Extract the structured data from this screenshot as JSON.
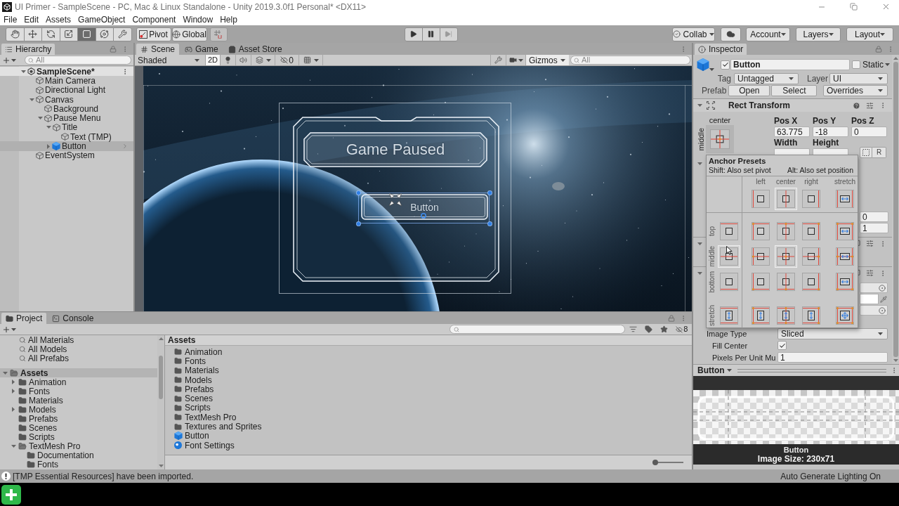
{
  "window": {
    "title": "UI Primer - SampleScene - PC, Mac & Linux Standalone - Unity 2019.3.0f1 Personal* <DX11>"
  },
  "menu": [
    "File",
    "Edit",
    "Assets",
    "GameObject",
    "Component",
    "Window",
    "Help"
  ],
  "toolbar": {
    "tools": [
      {
        "kind": "hand",
        "selected": false
      },
      {
        "kind": "move",
        "selected": false
      },
      {
        "kind": "rotate",
        "selected": false
      },
      {
        "kind": "scale",
        "selected": false
      },
      {
        "kind": "rect",
        "selected": true
      },
      {
        "kind": "transform",
        "selected": false
      },
      {
        "kind": "custom",
        "selected": false
      }
    ],
    "pivot": "Pivot",
    "global": "Global",
    "snap": {
      "disabled": true
    },
    "playback": [
      {
        "kind": "play",
        "disabled": false
      },
      {
        "kind": "pause",
        "disabled": false
      },
      {
        "kind": "step",
        "disabled": true
      }
    ],
    "collab": "Collab",
    "account": "Account",
    "layers": "Layers",
    "layout": "Layout"
  },
  "hierarchy": {
    "title": "Hierarchy",
    "search_placeholder": "All",
    "tree": [
      {
        "label": "SampleScene*",
        "kind": "scene",
        "expanded": true,
        "selected": false,
        "children": [
          {
            "label": "Main Camera",
            "kind": "object",
            "selected": false
          },
          {
            "label": "Directional Light",
            "kind": "object",
            "selected": false
          },
          {
            "label": "Canvas",
            "kind": "object",
            "expanded": true,
            "selected": false,
            "children": [
              {
                "label": "Background",
                "kind": "object",
                "selected": false
              },
              {
                "label": "Pause Menu",
                "kind": "object",
                "expanded": true,
                "selected": false,
                "children": [
                  {
                    "label": "Title",
                    "kind": "object",
                    "expanded": true,
                    "selected": false,
                    "children": [
                      {
                        "label": "Text (TMP)",
                        "kind": "object",
                        "selected": false
                      }
                    ]
                  },
                  {
                    "label": "Button",
                    "kind": "prefab",
                    "expanded": false,
                    "selected": true
                  }
                ]
              }
            ]
          },
          {
            "label": "EventSystem",
            "kind": "object",
            "selected": false
          }
        ]
      }
    ]
  },
  "scene_view": {
    "tabs": [
      {
        "label": "Scene",
        "kind": "scene",
        "selected": true
      },
      {
        "label": "Game",
        "kind": "game",
        "selected": false
      },
      {
        "label": "Asset Store",
        "kind": "store",
        "selected": false
      }
    ],
    "shading": "Shaded",
    "mode_2d": {
      "label": "2D",
      "on": true
    },
    "lighting": {
      "on": false
    },
    "audio": {
      "on": false
    },
    "hidden_count": "0",
    "tools": {
      "on": false
    },
    "gizmos": "Gizmos",
    "search_placeholder": "All",
    "title_text": "Game Paused",
    "button_text": "Button"
  },
  "inspector": {
    "title": "Inspector",
    "object": {
      "active": true,
      "name": "Button",
      "static": false,
      "static_label": "Static"
    },
    "tag_label": "Tag",
    "tag": "Untagged",
    "layer_label": "Layer",
    "layer": "UI",
    "prefab_label": "Prefab",
    "prefab_buttons": [
      "Open",
      "Select"
    ],
    "overrides": "Overrides",
    "rect_transform": {
      "title": "Rect Transform",
      "anchor_h_label": "center",
      "anchor_v_label": "middle",
      "fields": [
        {
          "label": "Pos X",
          "value": "63.775"
        },
        {
          "label": "Pos Y",
          "value": "-18"
        },
        {
          "label": "Pos Z",
          "value": "0"
        }
      ],
      "size_labels": [
        "Width",
        "Height"
      ],
      "raw_button": "R",
      "pivot_values": [
        "0",
        "1"
      ]
    },
    "image": {
      "rows": [
        {
          "label": "Image Type",
          "kind": "dropdown",
          "value": "Sliced",
          "children": [
            {
              "label": "Fill Center",
              "kind": "checkbox",
              "checked": true
            },
            {
              "label": "Pixels Per Unit Mu",
              "kind": "field",
              "value": "1"
            }
          ]
        }
      ]
    },
    "preview": {
      "title": "Button",
      "label": "Button",
      "image_size": "Image Size: 230x71"
    }
  },
  "anchor_presets": {
    "title": "Anchor Presets",
    "hints": [
      "Shift: Also set pivot",
      "Alt: Also set position"
    ],
    "columns": [
      {
        "label": "left",
        "selected": false
      },
      {
        "label": "center",
        "selected": true
      },
      {
        "label": "right",
        "selected": false
      },
      {
        "label": "stretch",
        "selected": false
      }
    ],
    "rows": [
      {
        "label": "top",
        "selected": false
      },
      {
        "label": "middle",
        "selected": true
      },
      {
        "label": "bottom",
        "selected": false
      },
      {
        "label": "stretch",
        "selected": false
      }
    ]
  },
  "project": {
    "tabs": [
      {
        "label": "Project",
        "kind": "project",
        "selected": true
      },
      {
        "label": "Console",
        "kind": "console",
        "selected": false
      }
    ],
    "hidden_count": "8",
    "favorites": [
      "All Materials",
      "All Models",
      "All Prefabs"
    ],
    "tree": [
      {
        "label": "Assets",
        "expanded": true,
        "selected": true,
        "children": [
          {
            "label": "Animation",
            "expanded": false,
            "selected": false
          },
          {
            "label": "Fonts",
            "expanded": false,
            "selected": false
          },
          {
            "label": "Materials",
            "selected": false
          },
          {
            "label": "Models",
            "expanded": false,
            "selected": false
          },
          {
            "label": "Prefabs",
            "selected": false
          },
          {
            "label": "Scenes",
            "selected": false
          },
          {
            "label": "Scripts",
            "selected": false
          },
          {
            "label": "TextMesh Pro",
            "expanded": true,
            "selected": false,
            "children": [
              {
                "label": "Documentation",
                "selected": false
              },
              {
                "label": "Fonts",
                "selected": false
              }
            ]
          }
        ]
      }
    ],
    "folder_title": "Assets",
    "items": [
      {
        "label": "Animation",
        "kind": "folder"
      },
      {
        "label": "Fonts",
        "kind": "folder"
      },
      {
        "label": "Materials",
        "kind": "folder"
      },
      {
        "label": "Models",
        "kind": "folder"
      },
      {
        "label": "Prefabs",
        "kind": "folder"
      },
      {
        "label": "Scenes",
        "kind": "folder"
      },
      {
        "label": "Scripts",
        "kind": "folder"
      },
      {
        "label": "TextMesh Pro",
        "kind": "folder"
      },
      {
        "label": "Textures and Sprites",
        "kind": "folder"
      },
      {
        "label": "Button",
        "kind": "prefab"
      },
      {
        "label": "Font Settings",
        "kind": "asset"
      }
    ],
    "zoom_slider": {
      "level": 0.1
    }
  },
  "status_bar": {
    "message": "[TMP Essential Resources] have been imported.",
    "right": "Auto Generate Lighting On"
  }
}
